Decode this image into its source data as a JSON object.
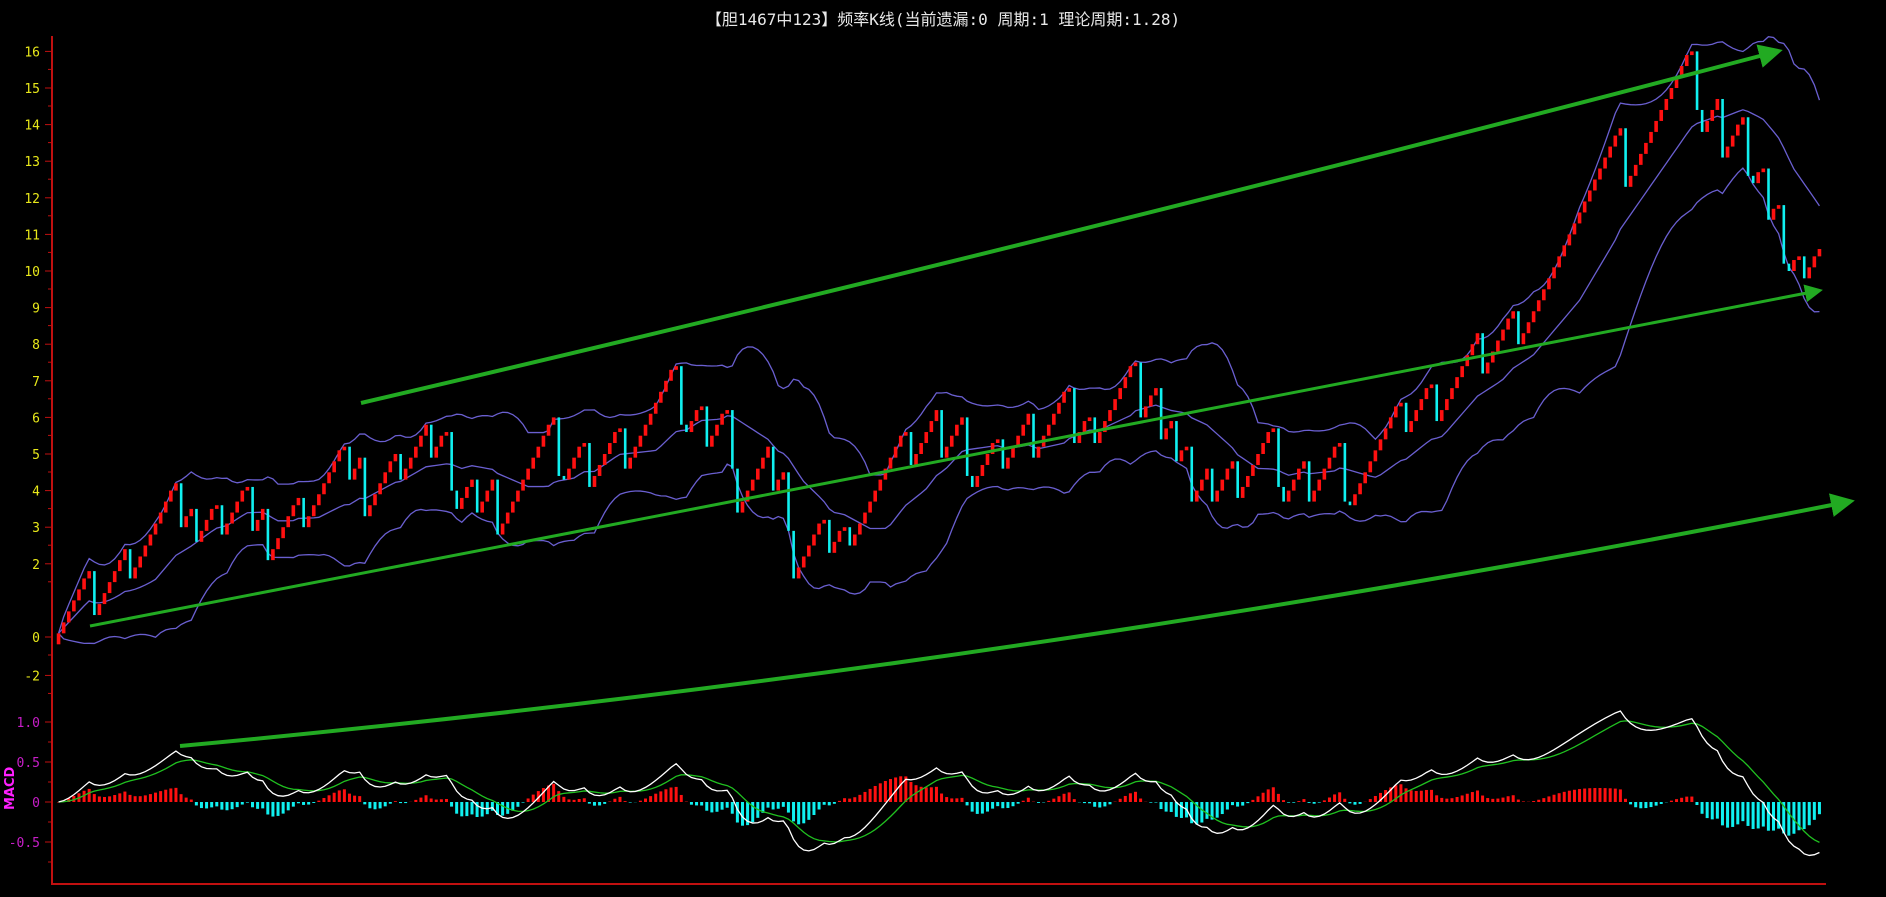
{
  "title": "【胆1467中123】频率K线(当前遗漏:0 周期:1 理论周期:1.28)",
  "colors": {
    "up": "#ff1010",
    "down": "#10f0f0",
    "band": "#6a5fd0",
    "axis": "#c01010",
    "price_tick": "#e8e81a",
    "macd_tick": "#c81ec8",
    "dif": "#ffffff",
    "dea": "#20c020",
    "arrow": "#22aa22"
  },
  "chart_data": {
    "type": "candlestick",
    "title": "【胆1467中123】频率K线(当前遗漏:0 周期:1 理论周期:1.28)",
    "price_axis": {
      "ticks": [
        {
          "label": "16",
          "value": 16
        },
        {
          "label": "15",
          "value": 15
        },
        {
          "label": "14",
          "value": 14
        },
        {
          "label": "13",
          "value": 13
        },
        {
          "label": "12",
          "value": 12
        },
        {
          "label": "11",
          "value": 11
        },
        {
          "label": "10",
          "value": 10
        },
        {
          "label": "9",
          "value": 9
        },
        {
          "label": "8",
          "value": 8
        },
        {
          "label": "7",
          "value": 7
        },
        {
          "label": "6",
          "value": 6
        },
        {
          "label": "5",
          "value": 5
        },
        {
          "label": "4",
          "value": 4
        },
        {
          "label": "3",
          "value": 3
        },
        {
          "label": "2",
          "value": 2
        },
        {
          "label": "0",
          "value": 0
        },
        {
          "label": "-2",
          "value": -1.05
        }
      ],
      "ylim": [
        -1.7,
        16.4
      ]
    },
    "macd_axis": {
      "label": "MACD",
      "ticks": [
        {
          "label": "1.0",
          "value": 1.0
        },
        {
          "label": "0.5",
          "value": 0.5
        },
        {
          "label": "0",
          "value": 0
        },
        {
          "label": "-0.5",
          "value": -0.5
        }
      ],
      "ylim": [
        -1.0,
        1.35
      ]
    },
    "step_up": 0.3,
    "max_drop_per_bar": 1.6,
    "price_turning_points": [
      -0.2,
      1.8,
      0.6,
      2.4,
      1.6,
      4.2,
      3.0,
      3.5,
      2.6,
      3.6,
      2.8,
      4.1,
      2.9,
      3.5,
      2.1,
      3.8,
      3.0,
      5.2,
      4.3,
      4.9,
      3.3,
      5.0,
      4.3,
      5.8,
      4.9,
      5.6,
      3.5,
      4.3,
      3.4,
      4.3,
      2.8,
      6.0,
      4.3,
      5.3,
      4.1,
      5.7,
      4.6,
      7.4,
      5.6,
      6.3,
      5.2,
      6.2,
      3.4,
      5.2,
      4.0,
      4.5,
      1.6,
      3.2,
      2.3,
      3.0,
      2.5,
      5.6,
      4.7,
      6.2,
      4.9,
      6.0,
      4.1,
      5.4,
      4.6,
      6.1,
      4.9,
      6.8,
      5.3,
      6.0,
      5.3,
      7.5,
      6.0,
      6.8,
      5.4,
      5.9,
      4.8,
      5.2,
      3.7,
      4.6,
      3.7,
      4.8,
      3.8,
      5.7,
      3.7,
      4.8,
      3.7,
      5.3,
      3.6,
      6.4,
      5.6,
      6.9,
      5.9,
      8.3,
      7.2,
      8.9,
      8.0,
      13.9,
      12.3,
      16.0,
      13.8,
      14.7,
      13.1,
      14.2,
      12.4,
      12.8,
      11.4,
      11.8,
      10.0,
      10.4,
      9.8,
      10.6
    ],
    "indicators": {
      "bollinger": {
        "period": 20,
        "k": 2
      },
      "macd": {
        "fast": 12,
        "slow": 26,
        "signal": 9
      }
    }
  }
}
